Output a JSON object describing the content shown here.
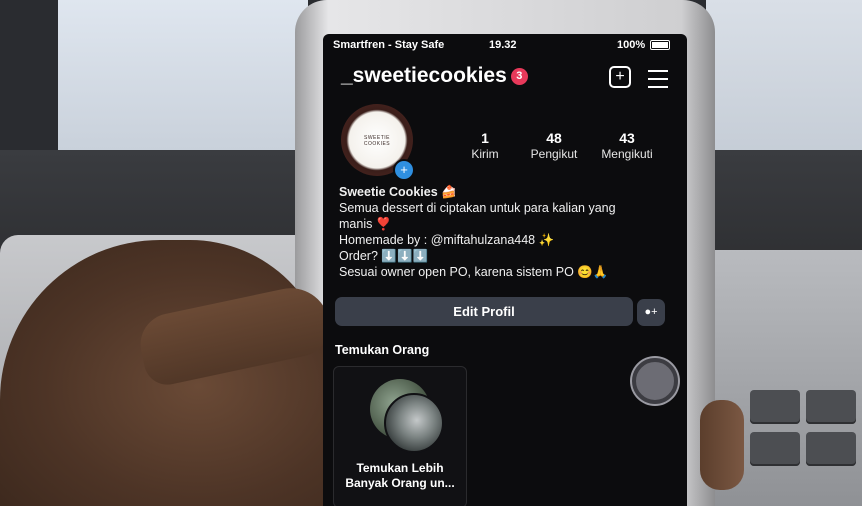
{
  "statusbar": {
    "carrier": "Smartfren - Stay Safe",
    "time": "19.32",
    "battery": "100%"
  },
  "profile": {
    "username": "_sweetiecookies",
    "notification_count": "3",
    "avatar_text": "SWEETIE COOKIES",
    "stats": [
      {
        "value": "1",
        "label": "Kirim"
      },
      {
        "value": "48",
        "label": "Pengikut"
      },
      {
        "value": "43",
        "label": "Mengikuti"
      }
    ],
    "bio": {
      "name": "Sweetie Cookies 🍰",
      "line1": "Semua dessert di ciptakan untuk para kalian yang",
      "line2": "manis ❣️",
      "line3": "Homemade by : @miftahulzana448 ✨",
      "line4": "Order? ⬇️⬇️⬇️",
      "line5": "Sesuai owner open PO, karena sistem PO 😊🙏"
    },
    "edit_button": "Edit Profil"
  },
  "discover": {
    "title": "Temukan Orang",
    "card_text_line1": "Temukan Lebih",
    "card_text_line2": "Banyak Orang un..."
  },
  "colors": {
    "screen_bg": "#0c0c0e",
    "button_bg": "#3a3f4a",
    "notif_badge": "#e8395a",
    "add_badge": "#2f8fe0"
  }
}
